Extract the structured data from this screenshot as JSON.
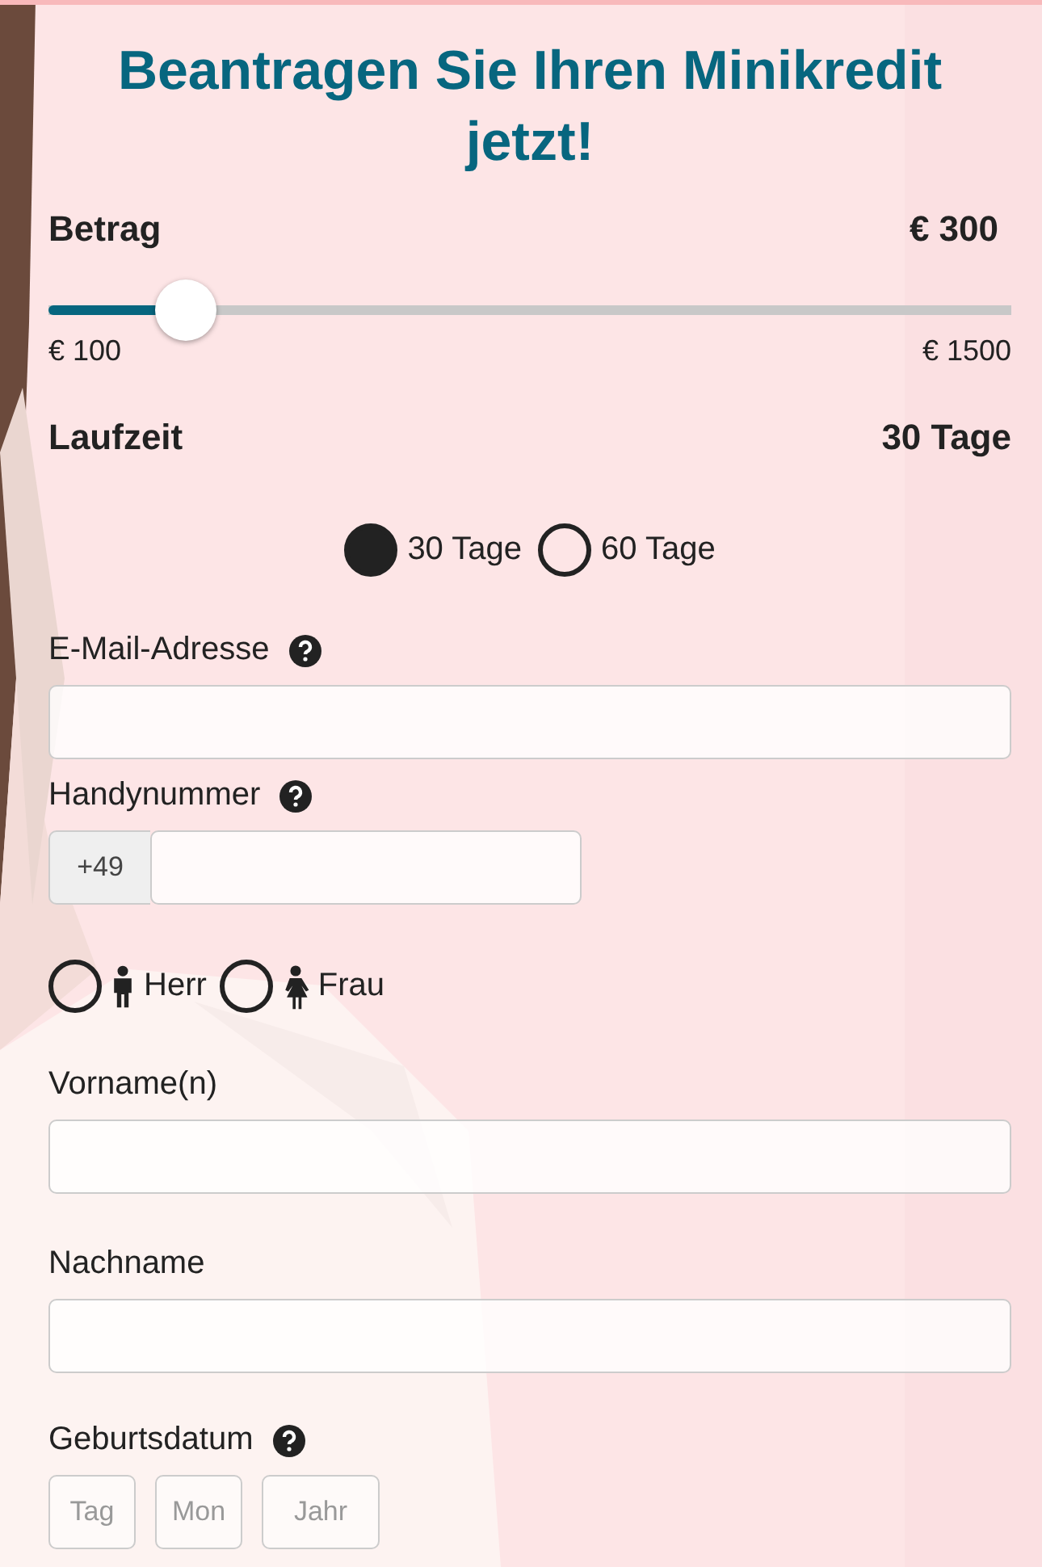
{
  "title": "Beantragen Sie Ihren Minikredit jetzt!",
  "amount": {
    "label": "Betrag",
    "value": "€ 300",
    "slider": {
      "level": 0.143,
      "min_label": "€ 100",
      "max_label": "€ 1500"
    }
  },
  "term": {
    "label": "Laufzeit",
    "value": "30 Tage",
    "options": [
      {
        "label": "30 Tage",
        "selected": true
      },
      {
        "label": "60 Tage",
        "selected": false
      }
    ]
  },
  "fields": [
    {
      "kind": "text",
      "label": "E-Mail-Adresse",
      "help": true
    },
    {
      "kind": "phone",
      "label": "Handynummer",
      "help": true,
      "prefix": "+49"
    },
    {
      "kind": "salutation",
      "options": [
        {
          "label": "Herr",
          "kind": "man",
          "selected": false
        },
        {
          "label": "Frau",
          "kind": "woman",
          "selected": false
        }
      ]
    },
    {
      "kind": "text",
      "label": "Vorname(n)",
      "help": false
    },
    {
      "kind": "text",
      "label": "Nachname",
      "help": false
    },
    {
      "kind": "date",
      "label": "Geburtsdatum",
      "help": true,
      "parts": [
        {
          "placeholder": "Tag"
        },
        {
          "placeholder": "Mon"
        },
        {
          "placeholder": "Jahr"
        }
      ]
    }
  ]
}
